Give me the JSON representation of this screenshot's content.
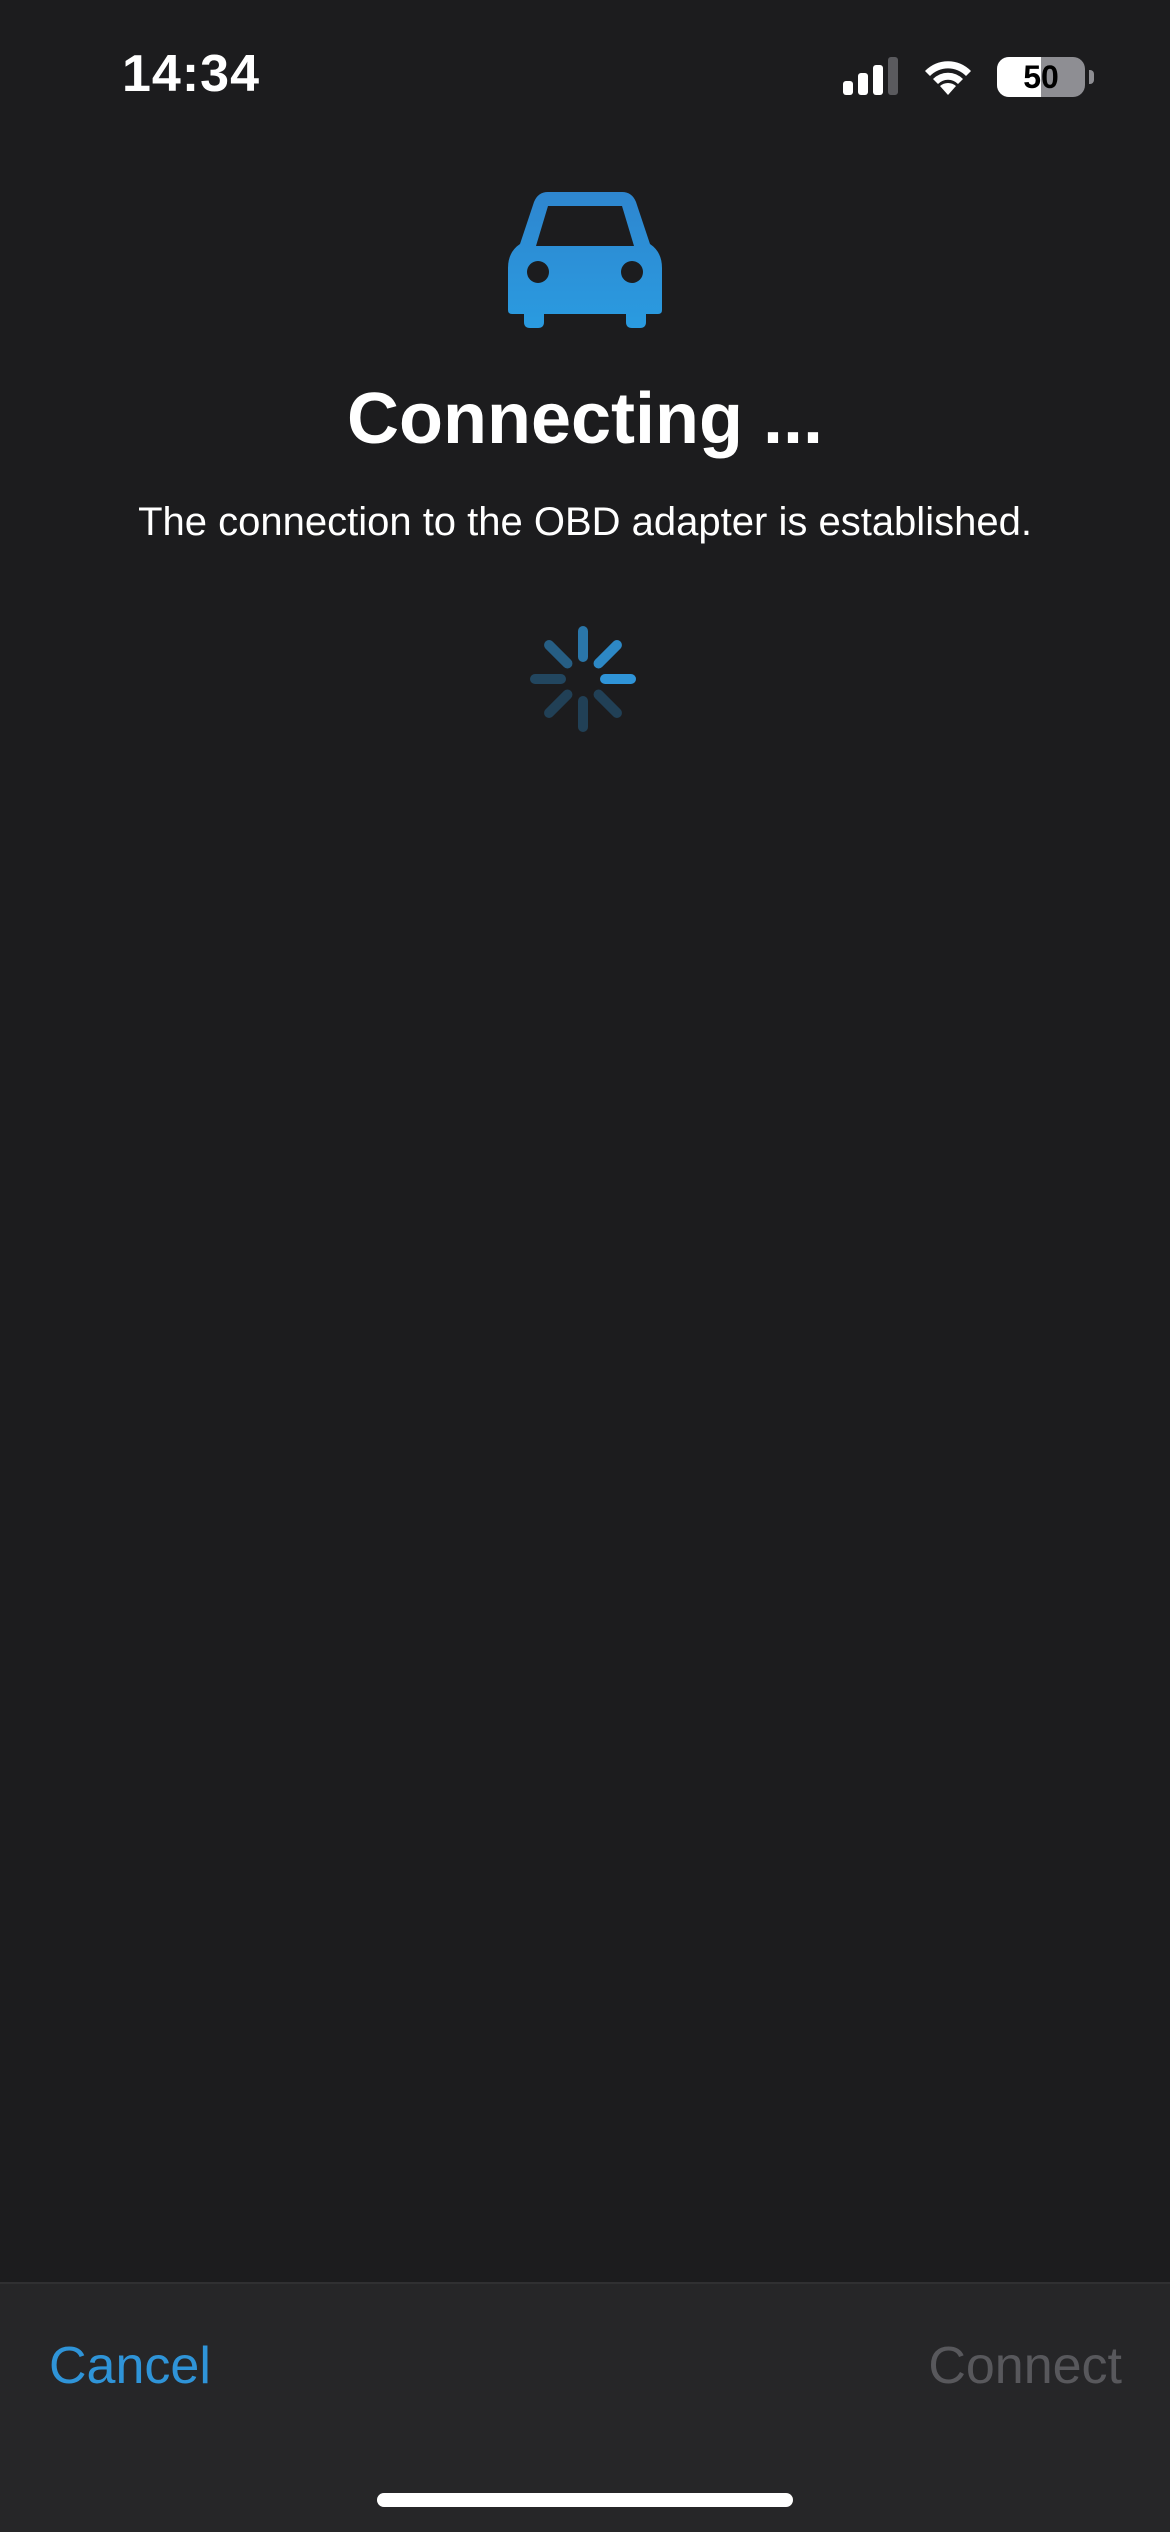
{
  "status_bar": {
    "time": "14:34",
    "battery_level": "50",
    "battery_fraction": 0.5,
    "icons": [
      "cellular-signal-icon",
      "wifi-icon",
      "battery-icon"
    ]
  },
  "main": {
    "icon": "car-icon",
    "title": "Connecting ...",
    "subtitle": "The connection to the OBD adapter is established.",
    "activity_indicator": "spinner-icon"
  },
  "toolbar": {
    "cancel_label": "Cancel",
    "connect_label": "Connect"
  },
  "colors": {
    "background": "#1c1c1e",
    "accent": "#2f94d8",
    "disabled": "#58585c",
    "toolbar_background": "#262628"
  }
}
